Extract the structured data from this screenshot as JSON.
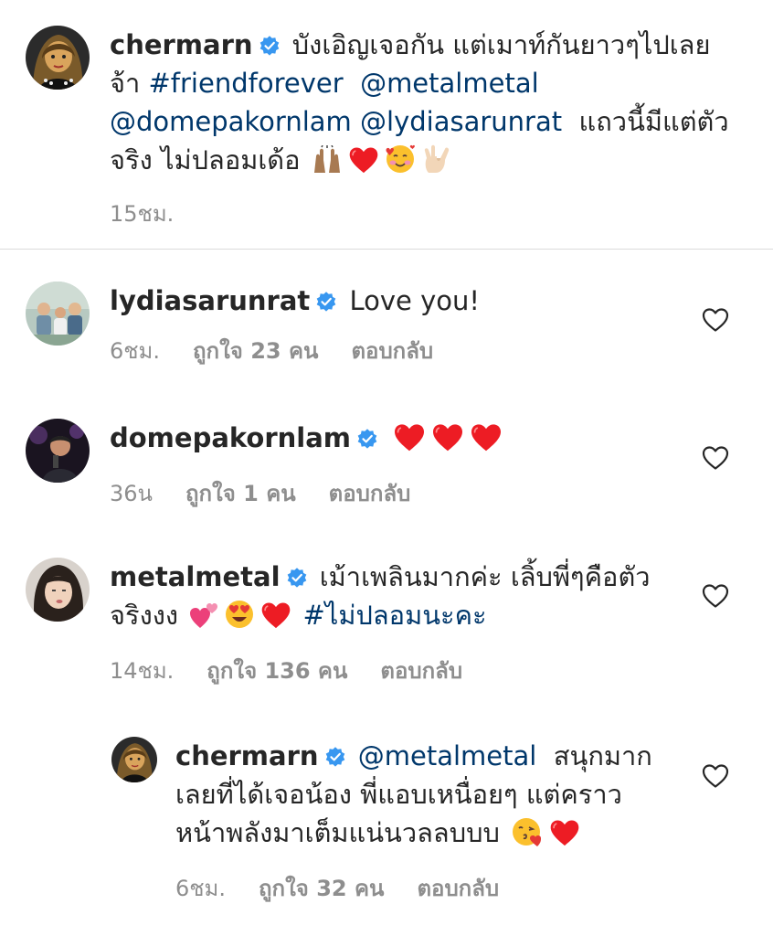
{
  "caption": {
    "username": "chermarn",
    "text_1": "บังเอิญเจอกัน แต่เมาท์กันยาวๆไปเลย",
    "text_2": "จ้า",
    "hashtag": "#friendforever",
    "mention_1": "@metalmetal",
    "mention_2": "@domepakornlam",
    "mention_3": "@lydiasarunrat",
    "text_3": "แถวนี้มีแต่ตัว",
    "text_4": "จริง ไม่ปลอมเด้อ",
    "time": "15ชม."
  },
  "comments": [
    {
      "username": "lydiasarunrat",
      "text": "Love you!",
      "time": "6ชม.",
      "likes": "ถูกใจ 23 คน",
      "reply": "ตอบกลับ"
    },
    {
      "username": "domepakornlam",
      "time": "36น",
      "likes": "ถูกใจ 1 คน",
      "reply": "ตอบกลับ"
    },
    {
      "username": "metalmetal",
      "text_1": "เม้าเพลินมากค่ะ เลิ้บพี่ๆคือตัว",
      "text_2": "จริงงง",
      "hashtag": "#ไม่ปลอมนะคะ",
      "time": "14ชม.",
      "likes": "ถูกใจ 136 คน",
      "reply": "ตอบกลับ"
    },
    {
      "username": "chermarn",
      "mention": "@metalmetal",
      "text_1": "สนุกมาก",
      "text_2": "เลยที่ได้เจอน้อง พี่แอบเหนื่อยๆ แต่คราว",
      "text_3": "หน้าพลังมาเต็มแน่นวลลบบบ",
      "time": "6ชม.",
      "likes": "ถูกใจ 32 คน",
      "reply": "ตอบกลับ"
    }
  ],
  "colors": {
    "text": "#262626",
    "link": "#00376b",
    "meta": "#8e8e8e",
    "verified": "#3897f0",
    "heart_red": "#ed1c24"
  },
  "icons": [
    "verified-badge-icon",
    "heart-outline-icon",
    "raising-hands-emoji",
    "red-heart-emoji",
    "smiling-face-hearts-emoji",
    "love-you-gesture-emoji",
    "two-hearts-emoji",
    "heart-eyes-emoji",
    "face-blowing-kiss-emoji"
  ]
}
